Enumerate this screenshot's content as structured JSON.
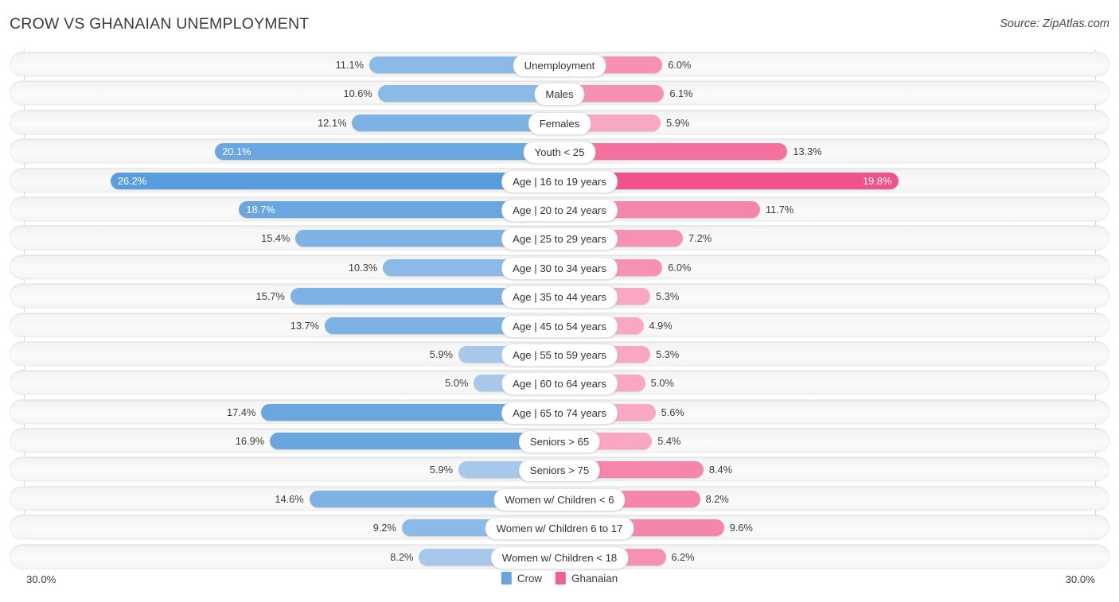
{
  "header": {
    "title": "CROW VS GHANAIAN UNEMPLOYMENT",
    "source": "Source: ZipAtlas.com"
  },
  "axis": {
    "left_max_label": "30.0%",
    "right_max_label": "30.0%",
    "max_value": 30.0
  },
  "legend": {
    "items": [
      {
        "label": "Crow",
        "color": "#6aa4dd"
      },
      {
        "label": "Ghanaian",
        "color": "#f0608f"
      }
    ]
  },
  "colors": {
    "crow_light": "#a7c8ea",
    "crow_mid": "#8cbae7",
    "crow_dark": "#599ddf",
    "ghanaian_light": "#f9a7c3",
    "ghanaian_mid": "#f791b4",
    "ghanaian_dark": "#f2528c"
  },
  "chart_data": {
    "type": "bar",
    "subtype": "diverging-bidirectional",
    "title": "CROW VS GHANAIAN UNEMPLOYMENT",
    "xlabel": "",
    "ylabel": "",
    "xlim": [
      -30.0,
      30.0
    ],
    "grid": true,
    "legend_position": "bottom-center",
    "unit": "%",
    "categories": [
      "Unemployment",
      "Males",
      "Females",
      "Youth < 25",
      "Age | 16 to 19 years",
      "Age | 20 to 24 years",
      "Age | 25 to 29 years",
      "Age | 30 to 34 years",
      "Age | 35 to 44 years",
      "Age | 45 to 54 years",
      "Age | 55 to 59 years",
      "Age | 60 to 64 years",
      "Age | 65 to 74 years",
      "Seniors > 65",
      "Seniors > 75",
      "Women w/ Children < 6",
      "Women w/ Children 6 to 17",
      "Women w/ Children < 18"
    ],
    "series": [
      {
        "name": "Crow",
        "side": "left",
        "values": [
          11.1,
          10.6,
          12.1,
          20.1,
          26.2,
          18.7,
          15.4,
          10.3,
          15.7,
          13.7,
          5.9,
          5.0,
          17.4,
          16.9,
          5.9,
          14.6,
          9.2,
          8.2
        ],
        "labels": [
          "11.1%",
          "10.6%",
          "12.1%",
          "20.1%",
          "26.2%",
          "18.7%",
          "15.4%",
          "10.3%",
          "15.7%",
          "13.7%",
          "5.9%",
          "5.0%",
          "17.4%",
          "16.9%",
          "5.9%",
          "14.6%",
          "9.2%",
          "8.2%"
        ]
      },
      {
        "name": "Ghanaian",
        "side": "right",
        "values": [
          6.0,
          6.1,
          5.9,
          13.3,
          19.8,
          11.7,
          7.2,
          6.0,
          5.3,
          4.9,
          5.3,
          5.0,
          5.6,
          5.4,
          8.4,
          8.2,
          9.6,
          6.2
        ],
        "labels": [
          "6.0%",
          "6.1%",
          "5.9%",
          "13.3%",
          "19.8%",
          "11.7%",
          "7.2%",
          "6.0%",
          "5.3%",
          "4.9%",
          "5.3%",
          "5.0%",
          "5.6%",
          "5.4%",
          "8.4%",
          "8.2%",
          "9.6%",
          "6.2%"
        ]
      }
    ]
  }
}
